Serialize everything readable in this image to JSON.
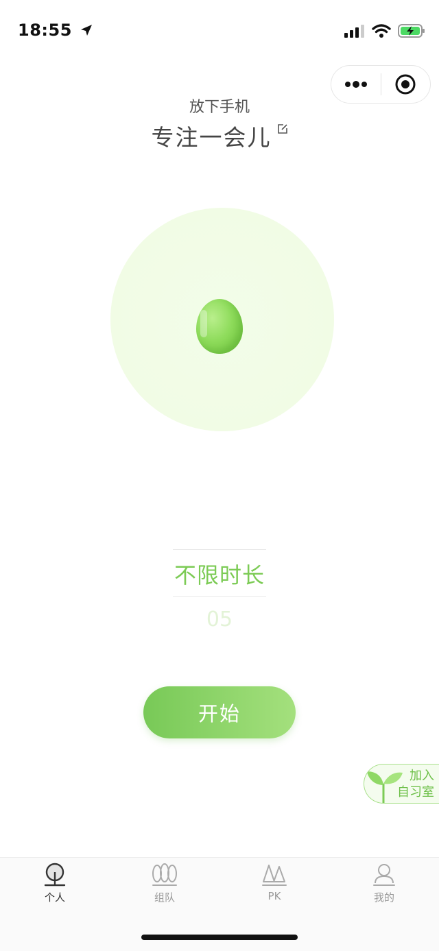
{
  "status_bar": {
    "time": "18:55"
  },
  "header": {
    "subtitle": "放下手机",
    "title": "专注一会儿"
  },
  "picker": {
    "selected": "不限时长",
    "next": "05"
  },
  "start_button": {
    "label": "开始"
  },
  "join_room": {
    "line1": "加入",
    "line2": "自习室"
  },
  "tabs": [
    {
      "label": "个人",
      "icon": "tree-icon",
      "active": true
    },
    {
      "label": "组队",
      "icon": "trees-group-icon",
      "active": false
    },
    {
      "label": "PK",
      "icon": "pine-trees-icon",
      "active": false
    },
    {
      "label": "我的",
      "icon": "user-icon",
      "active": false
    }
  ],
  "colors": {
    "accent": "#7ccb55",
    "button_start": "#78c957",
    "button_end": "#a4e07d",
    "circle": "#f1fce5"
  }
}
